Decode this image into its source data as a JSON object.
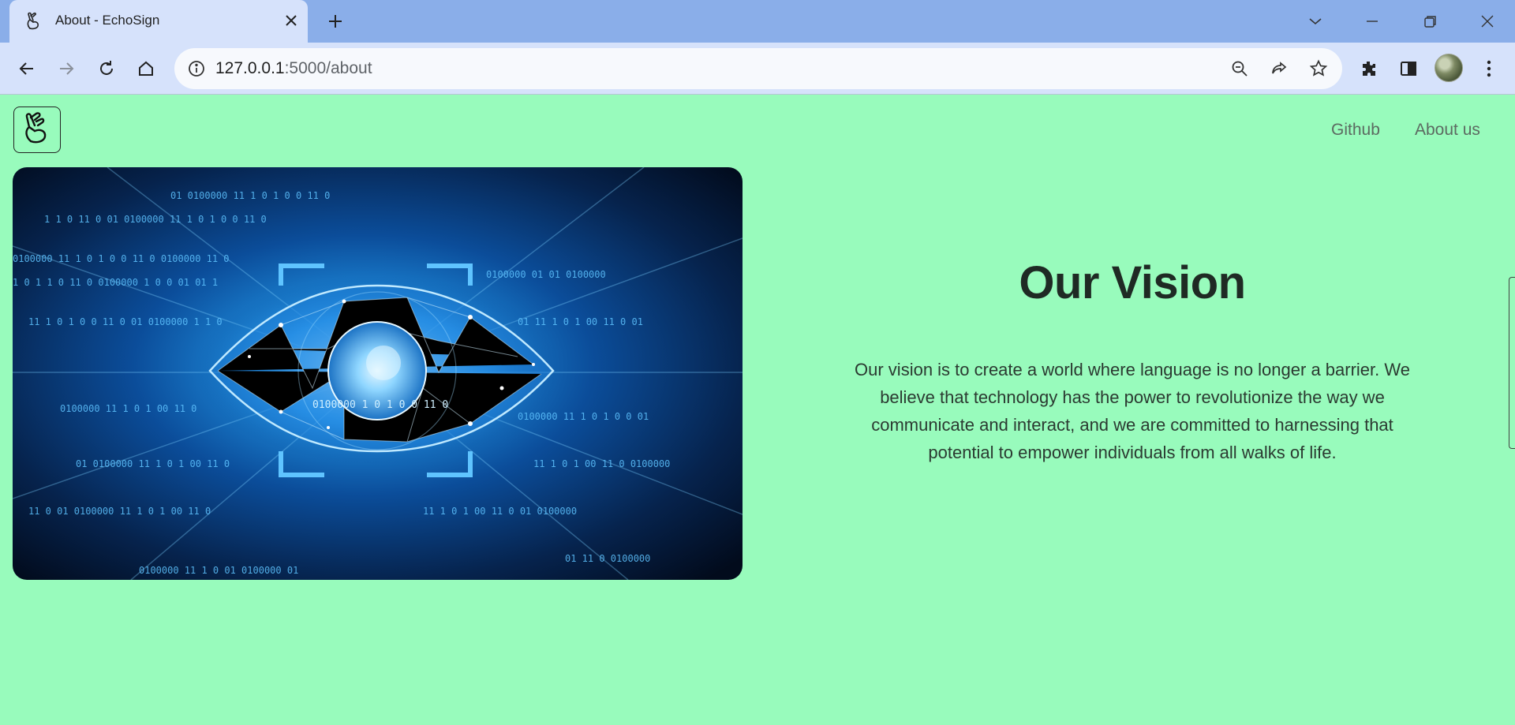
{
  "browser": {
    "tab_title": "About - EchoSign",
    "url_host": "127.0.0.1",
    "url_rest": ":5000/about"
  },
  "nav": {
    "links": [
      "Github",
      "About us"
    ]
  },
  "hero": {
    "image_alt": "Digital eye with binary code"
  },
  "vision": {
    "title": "Our Vision",
    "text": "Our vision is to create a world where language is no longer a barrier. We believe that technology has the power to revolutionize the way we communicate and interact, and we are committed to harnessing that potential to empower individuals from all walks of life."
  },
  "colors": {
    "page_background": "#98fbbc",
    "tabstrip": "#8aaee9",
    "toolbar": "#d6e2fb"
  },
  "icons": [
    "hand-logo-icon",
    "close-icon",
    "plus-icon",
    "chevron-down-icon",
    "minimize-icon",
    "restore-icon",
    "window-close-icon",
    "back-icon",
    "forward-icon",
    "reload-icon",
    "home-icon",
    "info-icon",
    "zoom-out-icon",
    "share-icon",
    "star-icon",
    "extensions-icon",
    "sidepanel-icon",
    "menu-icon"
  ]
}
